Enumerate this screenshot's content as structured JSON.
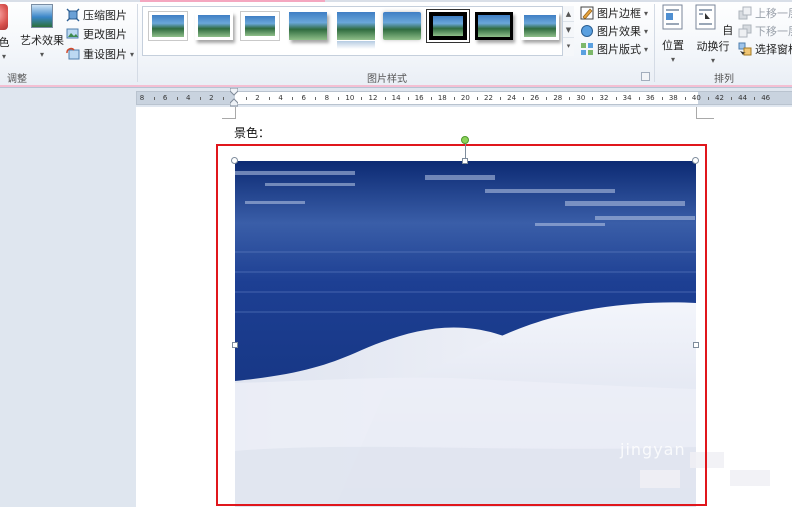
{
  "ribbon": {
    "adjust_group": {
      "label": "调整",
      "color_label": "颜色",
      "color_label_visible": "色",
      "artistic_label": "艺术效果",
      "compress_label": "压缩图片",
      "change_label": "更改图片",
      "reset_label": "重设图片"
    },
    "styles_group": {
      "label": "图片样式",
      "border_label": "图片边框",
      "effects_label": "图片效果",
      "layout_label": "图片版式"
    },
    "arrange_group": {
      "label": "排列",
      "position_label": "位置",
      "wrap_label": "自动换行",
      "bring_forward_label": "上移一层",
      "send_backward_label": "下移一层",
      "selection_pane_label": "选择窗格"
    }
  },
  "ruler": {
    "ticks": [
      "8",
      "6",
      "4",
      "2",
      "",
      "2",
      "4",
      "6",
      "8",
      "10",
      "12",
      "14",
      "16",
      "18",
      "20",
      "22",
      "24",
      "26",
      "28",
      "30",
      "32",
      "34",
      "36",
      "38",
      "40",
      "42",
      "44",
      "46"
    ]
  },
  "document": {
    "heading_text": "景色："
  },
  "watermark": {
    "text": "jingyan"
  },
  "colors": {
    "selection_frame": "#e0161c",
    "ribbon_accent": "#f4bfd3",
    "rotate_handle": "#8cd35a"
  }
}
